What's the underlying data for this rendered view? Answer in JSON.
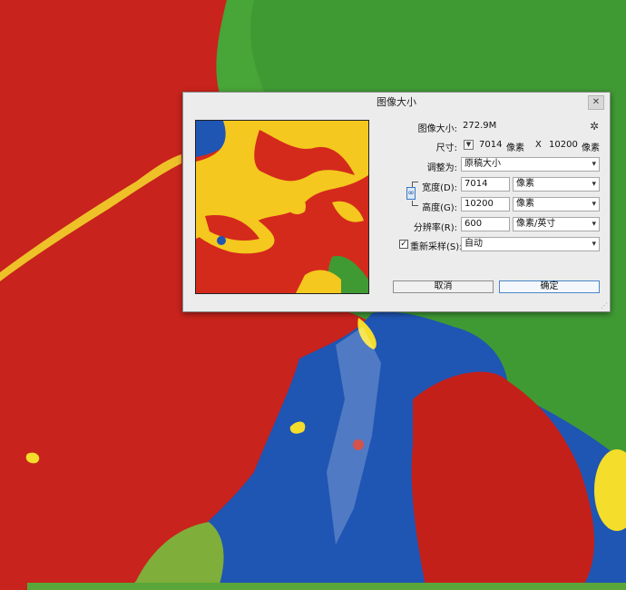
{
  "dialog": {
    "title": "图像大小",
    "close_icon": "✕",
    "image_size": {
      "label": "图像大小:",
      "value": "272.9M"
    },
    "dimensions": {
      "label": "尺寸:",
      "width": "7014",
      "unit1": "像素",
      "sep": "X",
      "height": "10200",
      "unit2": "像素"
    },
    "fit_to": {
      "label": "调整为:",
      "value": "原稿大小"
    },
    "width": {
      "label": "宽度(D):",
      "value": "7014",
      "unit": "像素"
    },
    "height": {
      "label": "高度(G):",
      "value": "10200",
      "unit": "像素"
    },
    "resolution": {
      "label": "分辨率(R):",
      "value": "600",
      "unit": "像素/英寸"
    },
    "resample": {
      "checked": true,
      "label": "重新采样(S):",
      "value": "自动"
    },
    "buttons": {
      "cancel": "取消",
      "ok": "确定"
    }
  },
  "icons": {
    "gear": "gear-icon",
    "close": "close-icon",
    "link": "chain-link-icon",
    "dropdown": "chevron-down-icon"
  },
  "colors": {
    "paint_red": "#c8231c",
    "paint_green": "#3f9a34",
    "paint_blue": "#1f55b3",
    "paint_yellow": "#f4dd2b",
    "dialog_bg": "#ececec",
    "primary_border": "#4a86c8"
  }
}
